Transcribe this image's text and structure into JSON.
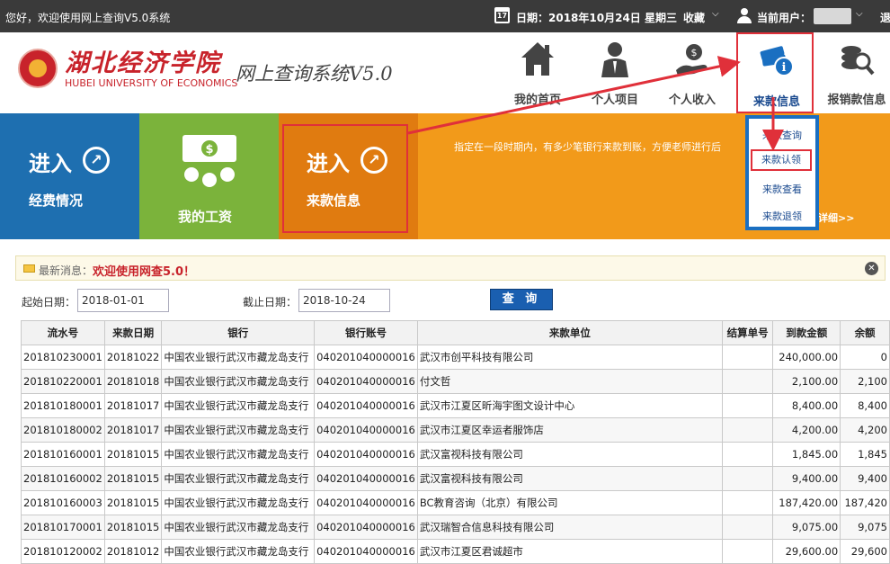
{
  "topbar": {
    "greeting": "您好，欢迎使用网上查询V5.0系统",
    "calendar_day": "17",
    "date": "日期：2018年10月24日 星期三",
    "favorites": "收藏",
    "current_user_label": "当前用户：",
    "logout": "退"
  },
  "header": {
    "logo_cn": "湖北经济学院",
    "logo_en": "HUBEI UNIVERSITY OF ECONOMICS",
    "system_title": "网上查询系统V5.0",
    "nav": [
      {
        "label": "我的首页",
        "icon": "house-icon"
      },
      {
        "label": "个人项目",
        "icon": "person-icon"
      },
      {
        "label": "个人收入",
        "icon": "hand-money-icon"
      },
      {
        "label": "来款信息",
        "icon": "money-info-icon"
      },
      {
        "label": "报销款信息",
        "icon": "coin-search-icon"
      }
    ]
  },
  "banner": {
    "tile1": {
      "enter": "进入",
      "sub": "经费情况"
    },
    "tile2": {
      "sub": "我的工资"
    },
    "tile3": {
      "enter": "进入",
      "sub": "来款信息"
    },
    "note": "指定在一段时期内，有多少笔银行来款到账，方便老师进行后",
    "more": "详细>>"
  },
  "dropdown": {
    "items": [
      "来款查询",
      "来款认领",
      "来款查看",
      "来款退领"
    ]
  },
  "notice": {
    "label": "最新消息：",
    "message": "欢迎使用网查5.0！"
  },
  "search": {
    "start_label": "起始日期：",
    "start_value": "2018-01-01",
    "end_label": "截止日期：",
    "end_value": "2018-10-24",
    "query_button": "查 询"
  },
  "table": {
    "headers": [
      "流水号",
      "来款日期",
      "银行",
      "银行账号",
      "来款单位",
      "结算单号",
      "到款金额",
      "余额"
    ],
    "rows": [
      [
        "201810230001",
        "20181022",
        "中国农业银行武汉市藏龙岛支行",
        "040201040000016",
        "武汉市创平科技有限公司",
        "",
        "240,000.00",
        "0"
      ],
      [
        "201810220001",
        "20181018",
        "中国农业银行武汉市藏龙岛支行",
        "040201040000016",
        "付文哲",
        "",
        "2,100.00",
        "2,100"
      ],
      [
        "201810180001",
        "20181017",
        "中国农业银行武汉市藏龙岛支行",
        "040201040000016",
        "武汉市江夏区昕海宇图文设计中心",
        "",
        "8,400.00",
        "8,400"
      ],
      [
        "201810180002",
        "20181017",
        "中国农业银行武汉市藏龙岛支行",
        "040201040000016",
        "武汉市江夏区幸运者服饰店",
        "",
        "4,200.00",
        "4,200"
      ],
      [
        "201810160001",
        "20181015",
        "中国农业银行武汉市藏龙岛支行",
        "040201040000016",
        "武汉富视科技有限公司",
        "",
        "1,845.00",
        "1,845"
      ],
      [
        "201810160002",
        "20181015",
        "中国农业银行武汉市藏龙岛支行",
        "040201040000016",
        "武汉富视科技有限公司",
        "",
        "9,400.00",
        "9,400"
      ],
      [
        "201810160003",
        "20181015",
        "中国农业银行武汉市藏龙岛支行",
        "040201040000016",
        "BC教育咨询（北京）有限公司",
        "",
        "187,420.00",
        "187,420"
      ],
      [
        "201810170001",
        "20181015",
        "中国农业银行武汉市藏龙岛支行",
        "040201040000016",
        "武汉瑞智合信息科技有限公司",
        "",
        "9,075.00",
        "9,075"
      ],
      [
        "201810120002",
        "20181012",
        "中国农业银行武汉市藏龙岛支行",
        "040201040000016",
        "武汉市江夏区君诚超市",
        "",
        "29,600.00",
        "29,600"
      ]
    ]
  },
  "colors": {
    "topbar": "#3a3a3a",
    "blue_tile": "#1e6fb0",
    "green_tile": "#7bb33b",
    "orange_tile": "#e07b10",
    "orange_banner": "#f29a1a",
    "highlight_red": "#e0303a",
    "dropdown_blue": "#1a6fc1"
  }
}
